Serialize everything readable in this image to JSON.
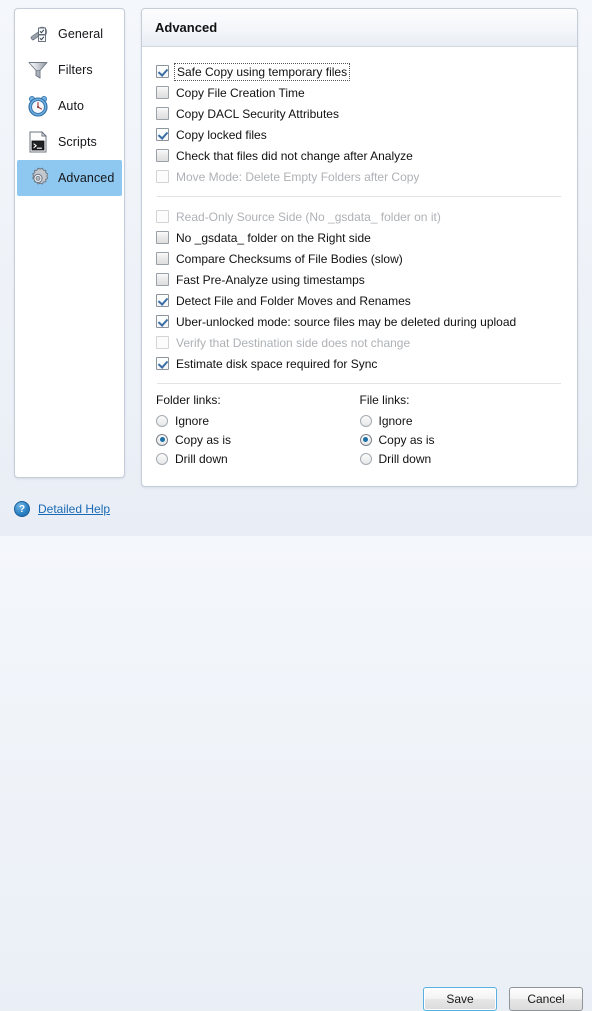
{
  "sidebar": {
    "items": [
      {
        "label": "General",
        "icon": "wrench-icon",
        "selected": false
      },
      {
        "label": "Filters",
        "icon": "funnel-icon",
        "selected": false
      },
      {
        "label": "Auto",
        "icon": "clock-icon",
        "selected": false
      },
      {
        "label": "Scripts",
        "icon": "script-icon",
        "selected": false
      },
      {
        "label": "Advanced",
        "icon": "gear-icon",
        "selected": true
      }
    ]
  },
  "panel": {
    "title": "Advanced",
    "group1": [
      {
        "label": "Safe Copy using temporary files",
        "checked": true,
        "disabled": false,
        "focused": true
      },
      {
        "label": "Copy File Creation Time",
        "checked": false,
        "disabled": false,
        "focused": false
      },
      {
        "label": "Copy DACL Security Attributes",
        "checked": false,
        "disabled": false,
        "focused": false
      },
      {
        "label": "Copy locked files",
        "checked": true,
        "disabled": false,
        "focused": false
      },
      {
        "label": "Check that files did not change after Analyze",
        "checked": false,
        "disabled": false,
        "focused": false
      },
      {
        "label": "Move Mode: Delete Empty Folders after Copy",
        "checked": false,
        "disabled": true,
        "focused": false
      }
    ],
    "group2": [
      {
        "label": "Read-Only Source Side (No _gsdata_ folder on it)",
        "checked": false,
        "disabled": true,
        "focused": false
      },
      {
        "label": "No _gsdata_ folder on the Right side",
        "checked": false,
        "disabled": false,
        "focused": false
      },
      {
        "label": "Compare Checksums of File Bodies (slow)",
        "checked": false,
        "disabled": false,
        "focused": false
      },
      {
        "label": "Fast Pre-Analyze using timestamps",
        "checked": false,
        "disabled": false,
        "focused": false
      },
      {
        "label": "Detect File and Folder Moves and Renames",
        "checked": true,
        "disabled": false,
        "focused": false
      },
      {
        "label": "Uber-unlocked mode: source files may be deleted during upload",
        "checked": true,
        "disabled": false,
        "focused": false
      },
      {
        "label": "Verify that Destination side does not change",
        "checked": false,
        "disabled": true,
        "focused": false
      },
      {
        "label": "Estimate disk space required for Sync",
        "checked": true,
        "disabled": false,
        "focused": false
      }
    ],
    "folder_links": {
      "title": "Folder links:",
      "options": [
        {
          "label": "Ignore",
          "selected": false
        },
        {
          "label": "Copy as is",
          "selected": true
        },
        {
          "label": "Drill down",
          "selected": false
        }
      ]
    },
    "file_links": {
      "title": "File links:",
      "options": [
        {
          "label": "Ignore",
          "selected": false
        },
        {
          "label": "Copy as is",
          "selected": true
        },
        {
          "label": "Drill down",
          "selected": false
        }
      ]
    }
  },
  "footer": {
    "help_icon": "help-circle-icon",
    "help_glyph": "?",
    "help_label": "Detailed Help",
    "save_label": "Save",
    "cancel_label": "Cancel"
  },
  "colors": {
    "selection": "#8ec8f0",
    "link": "#1a6ab5",
    "default_button_border": "#58b0e0",
    "check_mark": "#3a6ea5",
    "radio_dot": "#1d6fa5"
  }
}
